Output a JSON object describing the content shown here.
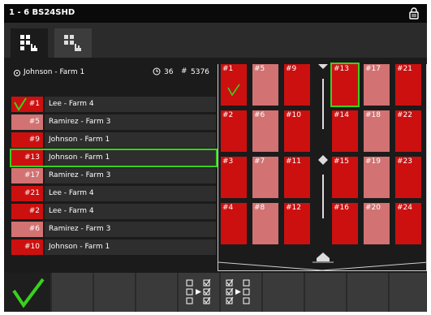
{
  "window": {
    "title": "1 - 6 BS24SHD",
    "lock_icon": "padlock-icon"
  },
  "tabs": [
    {
      "name": "grid-view-tab",
      "icon": "grid-hand-icon",
      "active": true
    },
    {
      "name": "grid-view-alt-tab",
      "icon": "grid-hand-icon",
      "active": false
    }
  ],
  "info": {
    "farm": "Johnson - Farm 1",
    "bales": "36",
    "hash": "#",
    "count": "5376",
    "clock_icon": "clock-icon"
  },
  "colors": {
    "red": "#cc1010",
    "pink": "#d27272",
    "green": "#38d21e",
    "panel": "#1b1b1b"
  },
  "rows": [
    {
      "num": "#1",
      "label": "Lee - Farm 4",
      "color": "red",
      "checked": true
    },
    {
      "num": "#5",
      "label": "Ramirez - Farm 3",
      "color": "pink"
    },
    {
      "num": "#9",
      "label": "Johnson - Farm 1",
      "color": "red"
    },
    {
      "num": "#13",
      "label": "Johnson - Farm 1",
      "color": "red",
      "selected": true
    },
    {
      "num": "#17",
      "label": "Ramirez - Farm 3",
      "color": "pink"
    },
    {
      "num": "#21",
      "label": "Lee - Farm 4",
      "color": "red"
    },
    {
      "num": "#2",
      "label": "Lee - Farm 4",
      "color": "red"
    },
    {
      "num": "#6",
      "label": "Ramirez - Farm 3",
      "color": "pink"
    },
    {
      "num": "#10",
      "label": "Johnson - Farm 1",
      "color": "red"
    }
  ],
  "cells": [
    {
      "num": "#1",
      "color": "red",
      "checked": true
    },
    {
      "num": "#5",
      "color": "pink"
    },
    {
      "num": "#9",
      "color": "red"
    },
    {
      "num": "#13",
      "color": "red",
      "selected": true
    },
    {
      "num": "#17",
      "color": "pink"
    },
    {
      "num": "#21",
      "color": "red"
    },
    {
      "num": "#2",
      "color": "red"
    },
    {
      "num": "#6",
      "color": "pink"
    },
    {
      "num": "#10",
      "color": "red"
    },
    {
      "num": "#14",
      "color": "red"
    },
    {
      "num": "#18",
      "color": "pink"
    },
    {
      "num": "#22",
      "color": "red"
    },
    {
      "num": "#3",
      "color": "red"
    },
    {
      "num": "#7",
      "color": "pink"
    },
    {
      "num": "#11",
      "color": "red"
    },
    {
      "num": "#15",
      "color": "red"
    },
    {
      "num": "#19",
      "color": "pink"
    },
    {
      "num": "#23",
      "color": "red"
    },
    {
      "num": "#4",
      "color": "red"
    },
    {
      "num": "#8",
      "color": "pink"
    },
    {
      "num": "#12",
      "color": "red"
    },
    {
      "num": "#16",
      "color": "red"
    },
    {
      "num": "#20",
      "color": "pink"
    },
    {
      "num": "#24",
      "color": "red"
    }
  ],
  "toolbar": {
    "confirm_icon": "checkmark-icon",
    "transfer_icon": "checkbox-transfer-icon",
    "transfer_back_icon": "checkbox-transfer-back-icon"
  }
}
